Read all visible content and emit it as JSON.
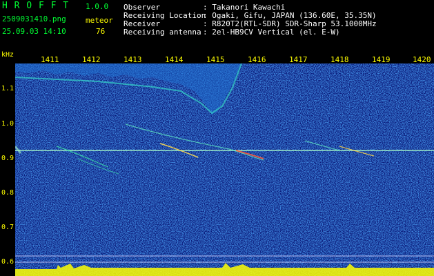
{
  "app": {
    "title": "H R O F F T",
    "version": "1.0.0"
  },
  "file": {
    "name": "2509031410.png",
    "type": "meteor",
    "datetime": "25.09.03 14:10",
    "count": "76"
  },
  "info": [
    {
      "label": "Observer",
      "value": ": Takanori Kawachi"
    },
    {
      "label": "Receiving Location",
      "value": ": Ogaki, Gifu, JAPAN (136.60E, 35.35N)"
    },
    {
      "label": "Receiver",
      "value": ": R820T2(RTL-SDR) SDR-Sharp 53.1000MHz"
    },
    {
      "label": "Receiving antenna",
      "value": ": 2el-HB9CV Vertical (el. E-W)"
    }
  ],
  "axis": {
    "y_unit": "kHz",
    "x_ticks": [
      "1411",
      "1412",
      "1413",
      "1414",
      "1415",
      "1416",
      "1417",
      "1418",
      "1419",
      "1420"
    ],
    "y_ticks": [
      "1.1",
      "1.0",
      "0.9",
      "0.8",
      "0.7",
      "0.6"
    ]
  },
  "colors": {
    "header_green": "#00ff33",
    "header_yellow": "#ffff00",
    "background_blue": "#0a1a7a",
    "carrier": "#aaffcc",
    "level_bar": "#ffff00"
  }
}
